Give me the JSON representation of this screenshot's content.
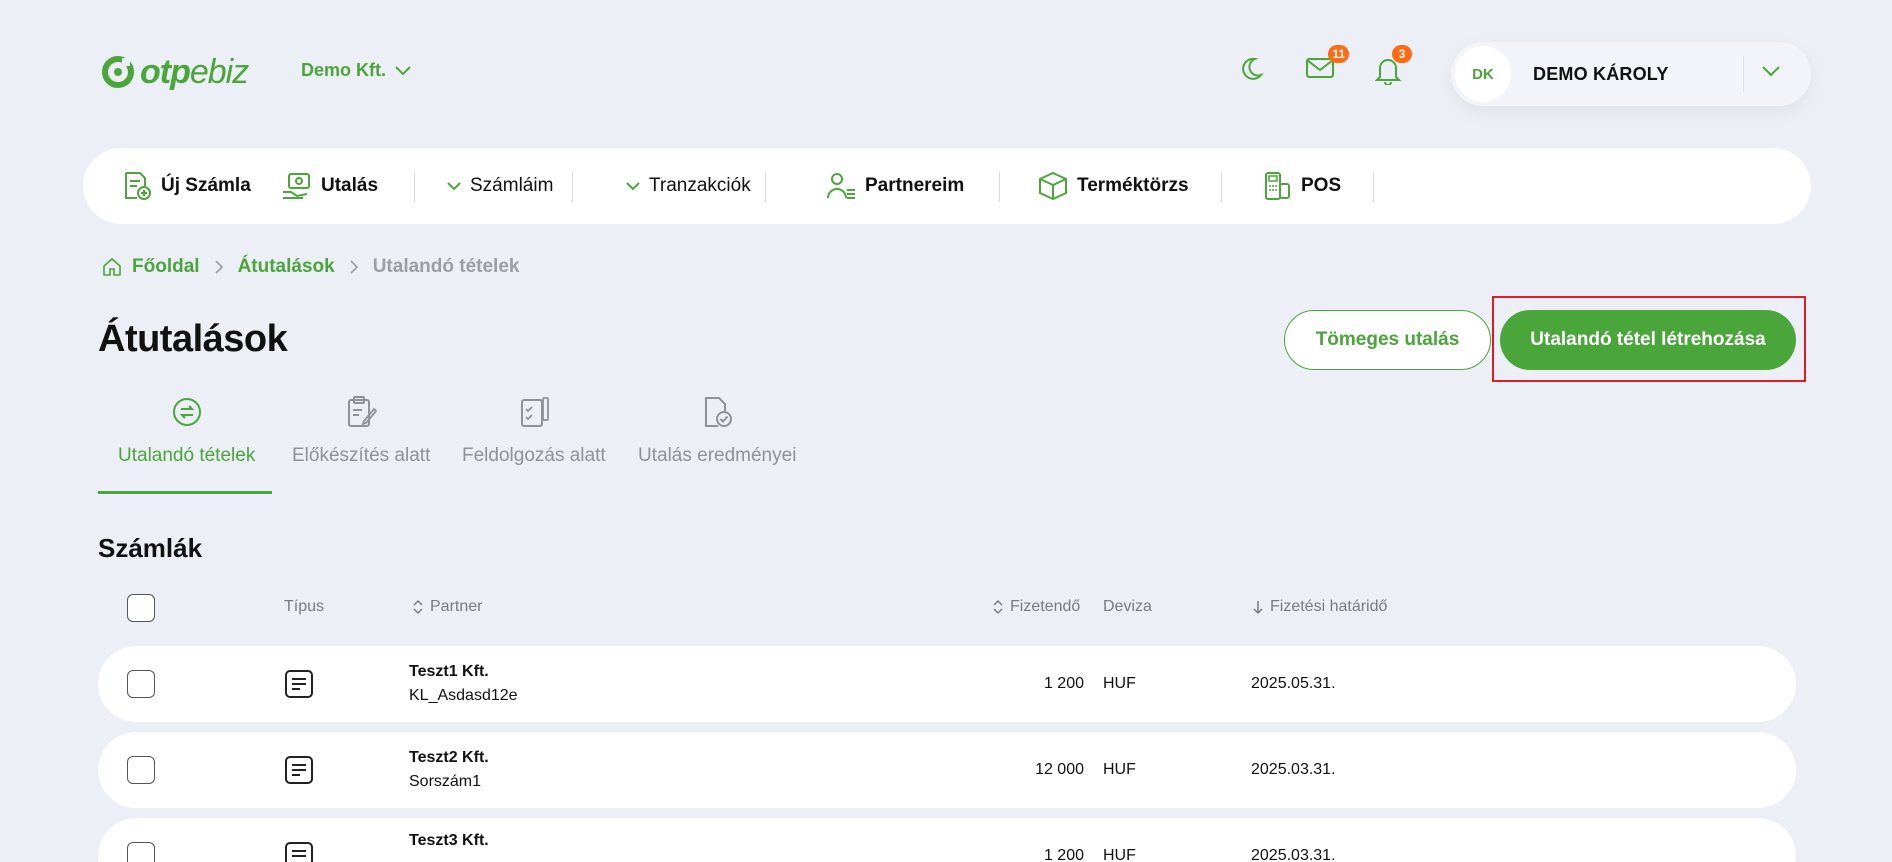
{
  "header": {
    "logo_text_bold": "otp",
    "logo_text_light": "ebiz",
    "company": "Demo Kft.",
    "messages_count": "11",
    "notifications_count": "3",
    "user_initials": "DK",
    "user_name": "DEMO KÁROLY"
  },
  "nav": {
    "items": [
      {
        "label": "Új Számla"
      },
      {
        "label": "Utalás"
      },
      {
        "label": "Számláim"
      },
      {
        "label": "Tranzakciók"
      },
      {
        "label": "Partnereim"
      },
      {
        "label": "Terméktörzs"
      },
      {
        "label": "POS"
      }
    ]
  },
  "breadcrumb": {
    "home": "Főoldal",
    "section": "Átutalások",
    "current": "Utalandó tételek"
  },
  "page": {
    "title": "Átutalások",
    "bulk_button": "Tömeges utalás",
    "create_button": "Utalandó tétel létrehozása"
  },
  "tabs": [
    {
      "label": "Utalandó tételek"
    },
    {
      "label": "Előkészítés alatt"
    },
    {
      "label": "Feldolgozás alatt"
    },
    {
      "label": "Utalás eredményei"
    }
  ],
  "table": {
    "title": "Számlák",
    "headers": {
      "type": "Típus",
      "partner": "Partner",
      "amount": "Fizetendő",
      "currency": "Deviza",
      "due": "Fizetési határidő"
    },
    "rows": [
      {
        "partner": "Teszt1 Kft.",
        "ref": "KL_Asdasd12e",
        "amount": "1 200",
        "currency": "HUF",
        "due": "2025.05.31."
      },
      {
        "partner": "Teszt2 Kft.",
        "ref": "Sorszám1",
        "amount": "12 000",
        "currency": "HUF",
        "due": "2025.03.31."
      },
      {
        "partner": "Teszt3 Kft.",
        "ref": "",
        "amount": "1 200",
        "currency": "HUF",
        "due": "2025.03.31."
      }
    ]
  },
  "colors": {
    "accent": "#4aa63a",
    "badge": "#ff6a13",
    "background": "#eceff6",
    "highlight": "#e01b24"
  }
}
